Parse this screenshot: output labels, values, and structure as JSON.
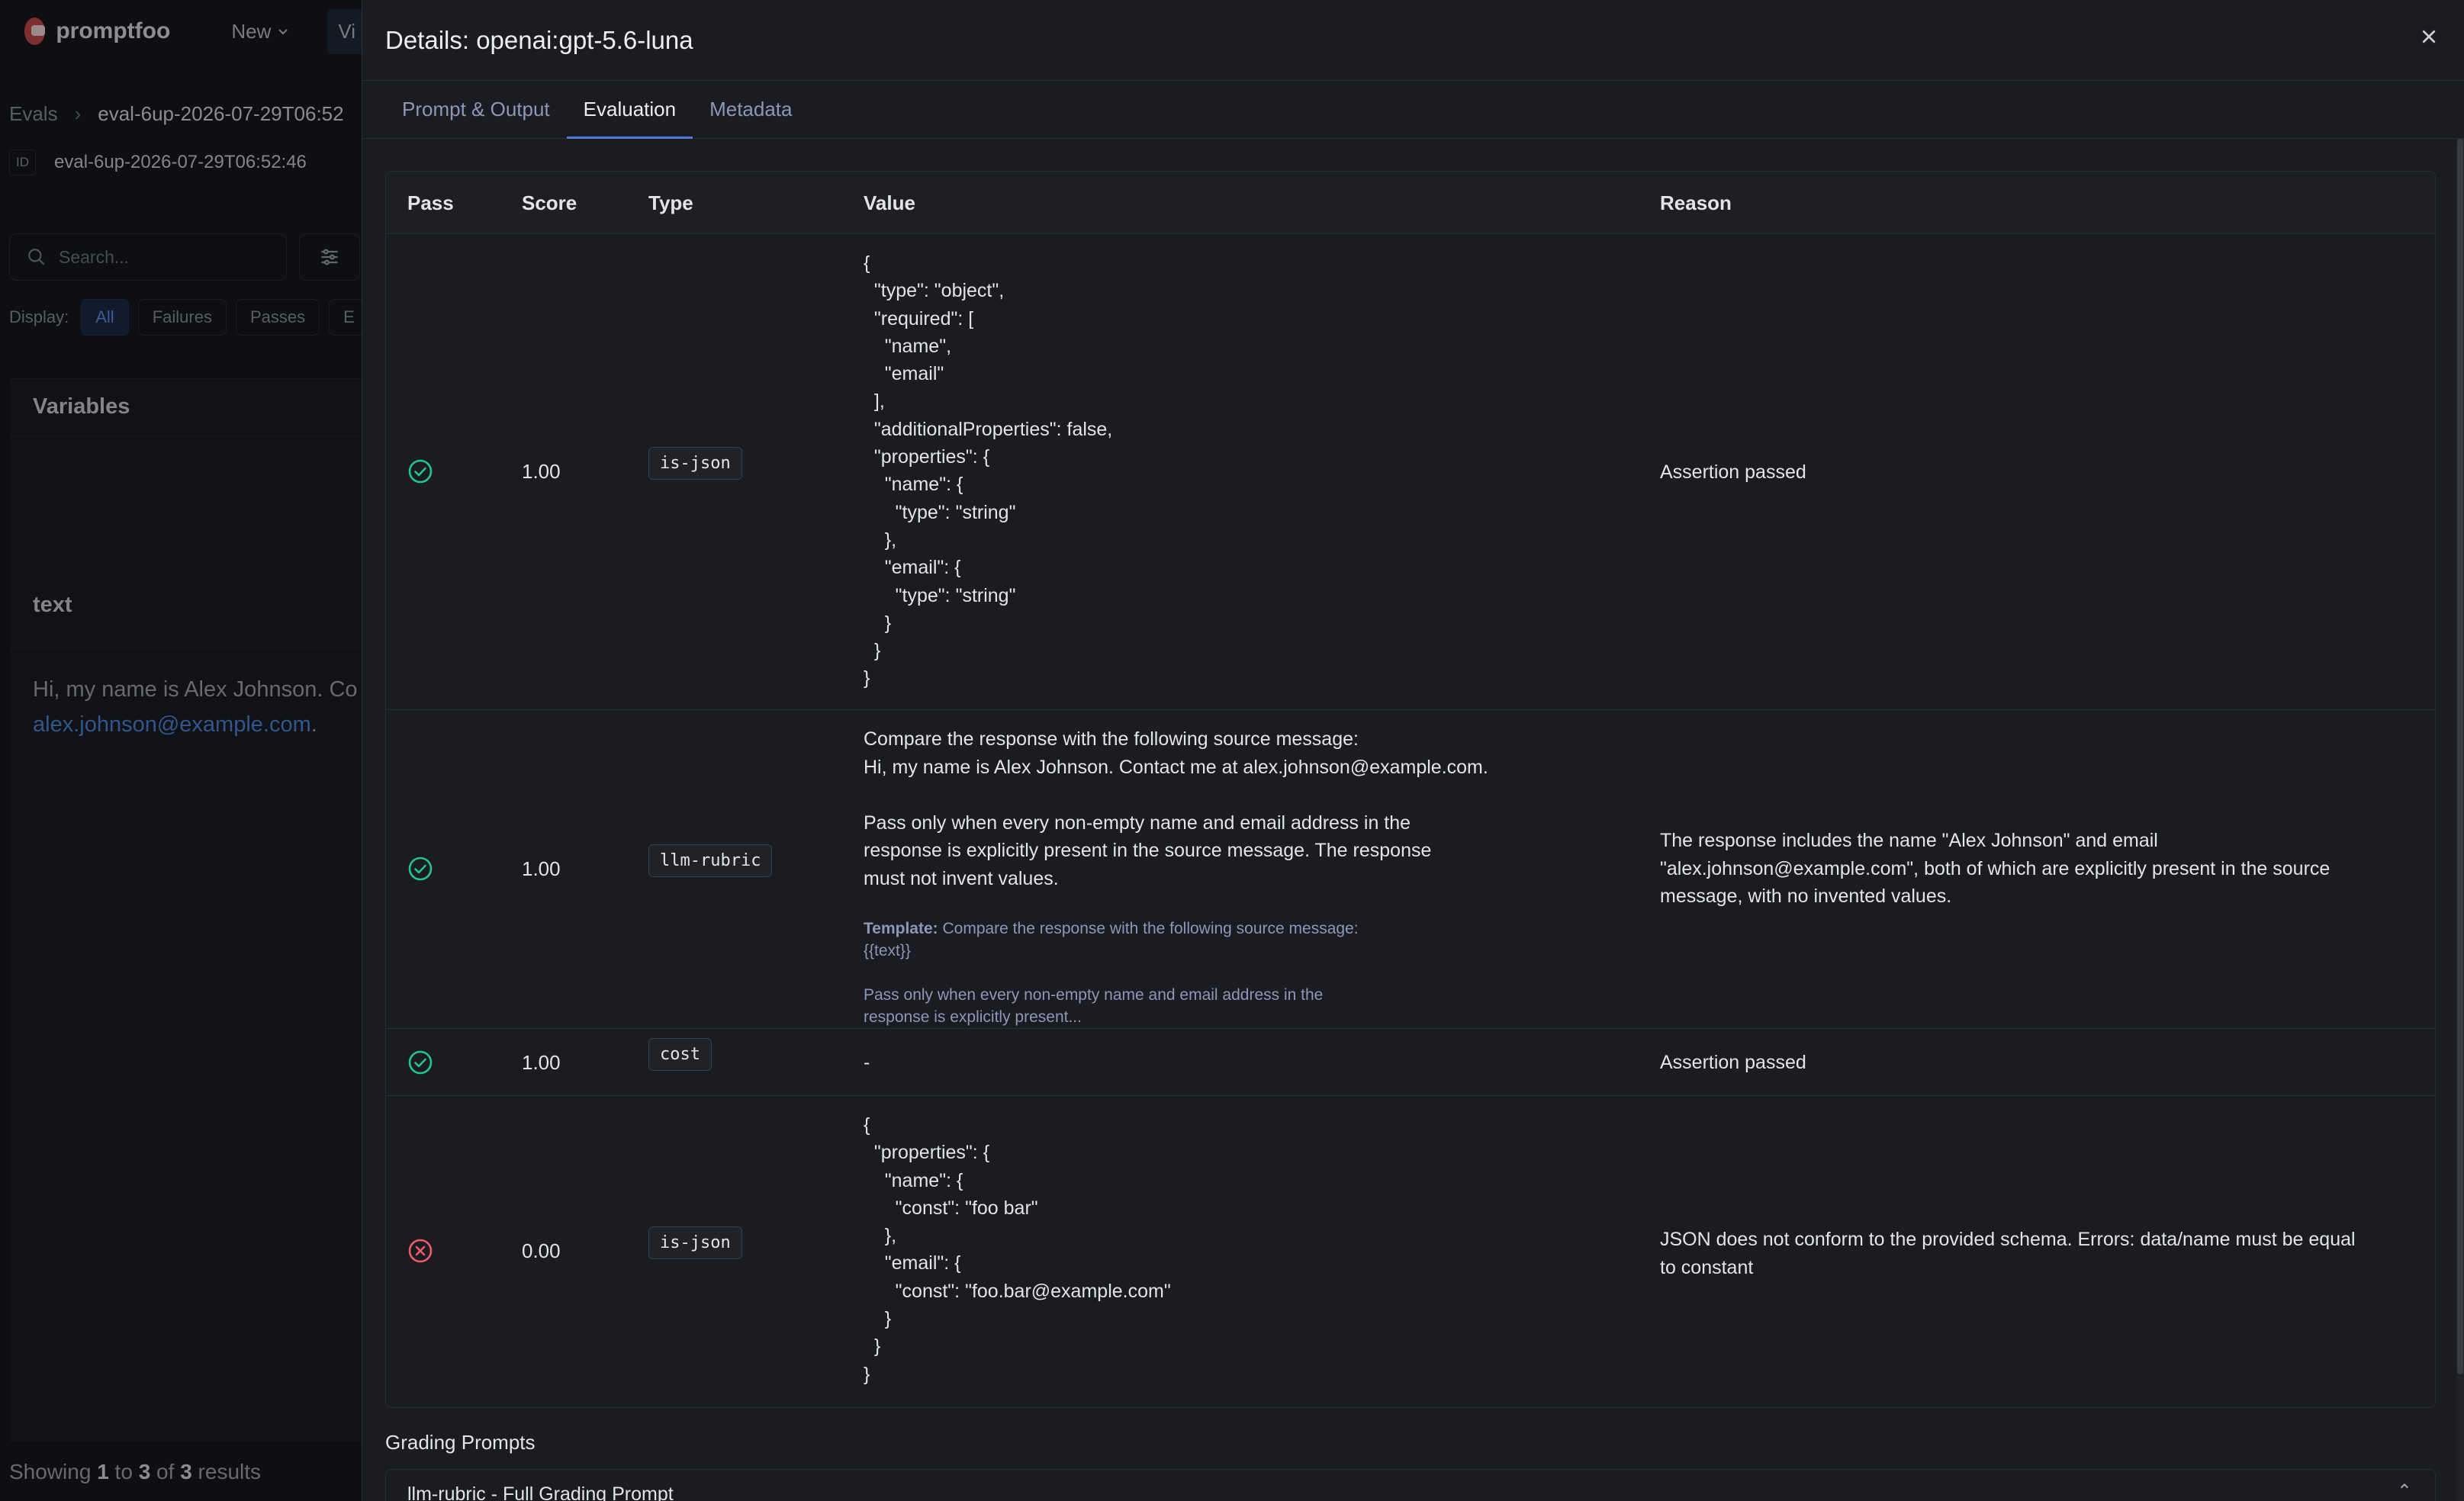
{
  "app": {
    "brand": "promptfoo",
    "nav_new": "New",
    "nav_view_partial": "Vi",
    "breadcrumb_evals": "Evals",
    "breadcrumb_current": "eval-6up-2026-07-29T06:52",
    "id_tag": "ID",
    "eval_id": "eval-6up-2026-07-29T06:52:46",
    "search_placeholder": "Search...",
    "display_label": "Display:",
    "display_options": [
      "All",
      "Failures",
      "Passes",
      "E"
    ],
    "variables_title": "Variables",
    "var_name": "text",
    "var_value_line1": "Hi, my name is Alex Johnson. Co",
    "var_value_email": "alex.johnson@example.com",
    "var_value_end": ".",
    "footer_prefix": "Showing ",
    "footer_from": "1",
    "footer_mid1": " to ",
    "footer_to": "3",
    "footer_mid2": " of ",
    "footer_total": "3",
    "footer_suffix": " results"
  },
  "drawer": {
    "title": "Details: openai:gpt-5.6-luna",
    "close_label": "×",
    "tabs": [
      "Prompt & Output",
      "Evaluation",
      "Metadata"
    ],
    "active_tab": "Evaluation"
  },
  "table": {
    "headers": {
      "pass": "Pass",
      "score": "Score",
      "type": "Type",
      "value": "Value",
      "reason": "Reason"
    },
    "rows": [
      {
        "pass": true,
        "score": "1.00",
        "type": "is-json",
        "value": "{\n  \"type\": \"object\",\n  \"required\": [\n    \"name\",\n    \"email\"\n  ],\n  \"additionalProperties\": false,\n  \"properties\": {\n    \"name\": {\n      \"type\": \"string\"\n    },\n    \"email\": {\n      \"type\": \"string\"\n    }\n  }\n}",
        "reason": "Assertion passed"
      },
      {
        "pass": true,
        "score": "1.00",
        "type": "llm-rubric",
        "value": "Compare the response with the following source message:\nHi, my name is Alex Johnson. Contact me at alex.johnson@example.com.\n\nPass only when every non-empty name and email address in the\nresponse is explicitly present in the source message. The response\nmust not invent values.",
        "template_label": "Template:",
        "template_text": " Compare the response with the following source message:\n{{text}}\n\nPass only when every non-empty name and email address in the\nresponse is explicitly present...",
        "reason": "The response includes the name \"Alex Johnson\" and email\n\"alex.johnson@example.com\", both of which are explicitly present in the source\nmessage, with no invented values."
      },
      {
        "pass": true,
        "score": "1.00",
        "type": "cost",
        "value": "-",
        "reason": "Assertion passed"
      },
      {
        "pass": false,
        "score": "0.00",
        "type": "is-json",
        "value": "{\n  \"properties\": {\n    \"name\": {\n      \"const\": \"foo bar\"\n    },\n    \"email\": {\n      \"const\": \"foo.bar@example.com\"\n    }\n  }\n}",
        "reason": "JSON does not conform to the provided schema. Errors: data/name must be equal\nto constant"
      }
    ]
  },
  "grading": {
    "title": "Grading Prompts",
    "item_label": "llm-rubric - Full Grading Prompt"
  },
  "colors": {
    "pass": "#22c58a",
    "fail": "#ef5b6b",
    "accent": "#4a7ddc"
  }
}
